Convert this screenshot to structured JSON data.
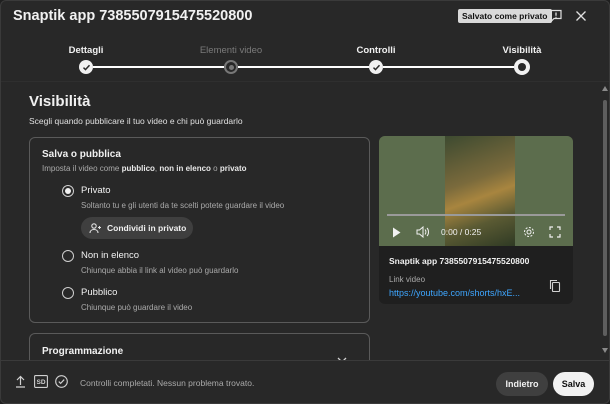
{
  "header": {
    "title": "Snaptik app 7385507915475520800",
    "saved_badge": "Salvato come privato"
  },
  "steps": [
    {
      "label": "Dettagli",
      "state": "done"
    },
    {
      "label": "Elementi video",
      "state": "skipped"
    },
    {
      "label": "Controlli",
      "state": "done"
    },
    {
      "label": "Visibilità",
      "state": "current"
    }
  ],
  "visibility": {
    "heading": "Visibilità",
    "subtitle": "Scegli quando pubblicare il tuo video e chi può guardarlo",
    "save_publish": {
      "title": "Salva o pubblica",
      "desc_prefix": "Imposta il video come ",
      "desc_public": "pubblico",
      "desc_sep1": ", ",
      "desc_unlisted": "non in elenco",
      "desc_sep2": " o ",
      "desc_private": "privato",
      "options": [
        {
          "label": "Privato",
          "desc": "Soltanto tu e gli utenti da te scelti potete guardare il video",
          "selected": true
        },
        {
          "label": "Non in elenco",
          "desc": "Chiunque abbia il link al video può guardarlo",
          "selected": false
        },
        {
          "label": "Pubblico",
          "desc": "Chiunque può guardare il video",
          "selected": false
        }
      ],
      "share_button": "Condividi in privato"
    },
    "schedule": {
      "title": "Programmazione"
    }
  },
  "preview": {
    "time": "0:00 / 0:25",
    "video_name": "Snaptik app 7385507915475520800",
    "link_label": "Link video",
    "link": "https://youtube.com/shorts/hxE..."
  },
  "footer": {
    "hd_badge": "SD",
    "status": "Controlli completati. Nessun problema trovato.",
    "back_button": "Indietro",
    "save_button": "Salva"
  },
  "colors": {
    "background": "#282828",
    "link": "#3ea6ff",
    "primary_button": "#f1f1f1"
  }
}
